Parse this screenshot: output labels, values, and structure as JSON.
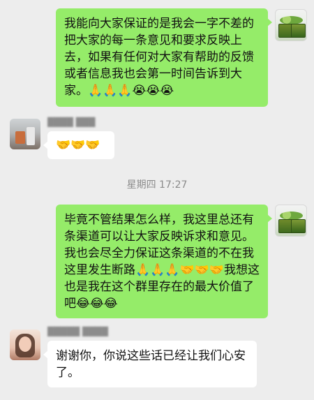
{
  "messages": [
    {
      "id": "m1",
      "side": "right",
      "text": "我能向大家保证的是我会一字不差的把大家的每一条意见和要求反映上去，如果有任何对大家有帮助的反馈或者信息我也会第一时间告诉到大家。🙏🙏🙏😭😭😭"
    },
    {
      "id": "m2",
      "side": "left",
      "sender": "████ ███",
      "text": "🤝🤝🤝"
    },
    {
      "id": "m3",
      "side": "right",
      "text": "毕竟不管结果怎么样，我这里总还有条渠道可以让大家反映诉求和意见。我也会尽全力保证这条渠道的不在我这里发生断路🙏🙏🙏🤝🤝🤝我想这也是我在这个群里存在的最大价值了吧😂😂😂"
    },
    {
      "id": "m4",
      "side": "left",
      "sender": "█████ ████",
      "text": "谢谢你，你说这些话已经让我们心安了。"
    }
  ],
  "time_separator": "星期四 17:27",
  "colors": {
    "background": "#ededed",
    "bubble_me": "#95ec69",
    "bubble_friend": "#ffffff",
    "meta_text": "#8a8a8a"
  },
  "icons": {
    "avatar_me": "avatar-produce-crates-icon",
    "avatar_friend_1": "avatar-shop-icon",
    "avatar_friend_2": "avatar-person-icon"
  }
}
